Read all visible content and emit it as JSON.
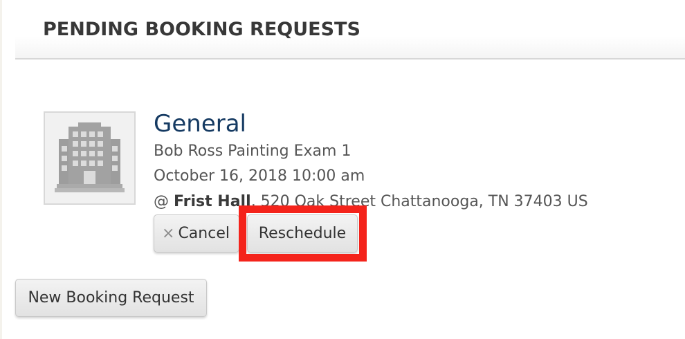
{
  "section": {
    "title": "PENDING BOOKING REQUESTS"
  },
  "booking": {
    "type": "General",
    "exam": "Bob Ross Painting Exam 1",
    "datetime": "October 16, 2018 10:00 am",
    "location_prefix": "@ ",
    "location_name": "Frist Hall",
    "location_address": ", 520 Oak Street Chattanooga, TN 37403 US",
    "thumbnail_icon": "building-icon"
  },
  "actions": {
    "cancel_icon": "×",
    "cancel_label": "Cancel",
    "reschedule_label": "Reschedule",
    "new_booking_label": "New Booking Request"
  },
  "colors": {
    "title": "#383838",
    "booking_type": "#153a62",
    "highlight": "#f4231b"
  }
}
